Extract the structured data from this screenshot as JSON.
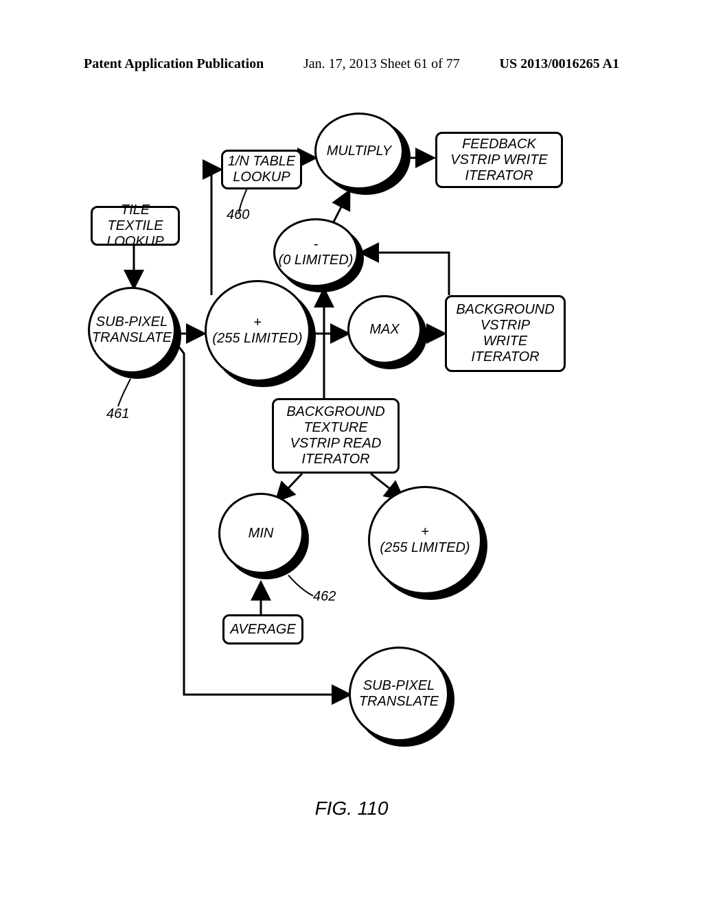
{
  "header": {
    "left": "Patent Application Publication",
    "mid": "Jan. 17, 2013  Sheet 61 of 77",
    "right": "US 2013/0016265 A1"
  },
  "nodes": {
    "lookup_1n": "1/N TABLE\nLOOKUP",
    "multiply": "MULTIPLY",
    "feedback_write": "FEEDBACK\nVSTRIP WRITE\nITERATOR",
    "tile_lookup": "TILE TEXTILE\nLOOKUP",
    "minus_0": "-\n(0 LIMITED)",
    "subpixel_1": "SUB-PIXEL\nTRANSLATE",
    "plus_255_l": "+\n(255 LIMITED)",
    "max": "MAX",
    "bg_write": "BACKGROUND\nVSTRIP\nWRITE\nITERATOR",
    "bg_read": "BACKGROUND\nTEXTURE\nVSTRIP READ\nITERATOR",
    "min": "MIN",
    "plus_255_r": "+\n(255 LIMITED)",
    "average": "AVERAGE",
    "subpixel_2": "SUB-PIXEL\nTRANSLATE"
  },
  "labels": {
    "l460": "460",
    "l461": "461",
    "l462": "462"
  },
  "figure": "FIG. 110",
  "chart_data": {
    "type": "diagram",
    "figure_id": "FIG. 110",
    "nodes": [
      {
        "id": "tile_lookup",
        "shape": "rect",
        "label": "TILE TEXTILE LOOKUP"
      },
      {
        "id": "lookup_1n",
        "shape": "rect",
        "label": "1/N TABLE LOOKUP",
        "ref": "460"
      },
      {
        "id": "multiply",
        "shape": "circle",
        "label": "MULTIPLY"
      },
      {
        "id": "feedback_write",
        "shape": "rect",
        "label": "FEEDBACK VSTRIP WRITE ITERATOR"
      },
      {
        "id": "minus_0",
        "shape": "circle",
        "label": "- (0 LIMITED)"
      },
      {
        "id": "subpixel_1",
        "shape": "circle",
        "label": "SUB-PIXEL TRANSLATE",
        "ref": "461"
      },
      {
        "id": "plus_255_l",
        "shape": "circle",
        "label": "+ (255 LIMITED)"
      },
      {
        "id": "max",
        "shape": "circle",
        "label": "MAX"
      },
      {
        "id": "bg_write",
        "shape": "rect",
        "label": "BACKGROUND VSTRIP WRITE ITERATOR"
      },
      {
        "id": "bg_read",
        "shape": "rect",
        "label": "BACKGROUND TEXTURE VSTRIP READ ITERATOR"
      },
      {
        "id": "min",
        "shape": "circle",
        "label": "MIN",
        "ref": "462"
      },
      {
        "id": "plus_255_r",
        "shape": "circle",
        "label": "+ (255 LIMITED)"
      },
      {
        "id": "average",
        "shape": "rect",
        "label": "AVERAGE"
      },
      {
        "id": "subpixel_2",
        "shape": "circle",
        "label": "SUB-PIXEL TRANSLATE"
      }
    ],
    "edges": [
      {
        "from": "tile_lookup",
        "to": "subpixel_1"
      },
      {
        "from": "subpixel_1",
        "to": "plus_255_l"
      },
      {
        "from": "subpixel_1",
        "to": "subpixel_2",
        "via": "down_right"
      },
      {
        "from": "plus_255_l",
        "to": "lookup_1n"
      },
      {
        "from": "plus_255_l",
        "to": "max"
      },
      {
        "from": "lookup_1n",
        "to": "multiply"
      },
      {
        "from": "multiply",
        "to": "feedback_write"
      },
      {
        "from": "minus_0",
        "to": "multiply"
      },
      {
        "from": "bg_write",
        "to": "minus_0"
      },
      {
        "from": "max",
        "to": "bg_write"
      },
      {
        "from": "bg_read",
        "to": "max"
      },
      {
        "from": "bg_read",
        "to": "minus_0"
      },
      {
        "from": "bg_read",
        "to": "min"
      },
      {
        "from": "bg_read",
        "to": "plus_255_r"
      },
      {
        "from": "average",
        "to": "min"
      }
    ]
  }
}
